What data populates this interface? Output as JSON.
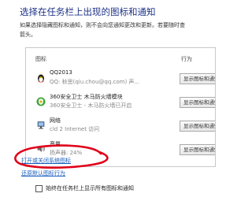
{
  "header": {
    "title": "选择在任务栏上出现的图标和通知",
    "description_line1": "如果选择隐藏图标和通知，则不会向您通知更改和更新。若要随时查",
    "description_line2": "箭头。"
  },
  "table": {
    "col_icon": "图标",
    "col_action": "行为",
    "rows": [
      {
        "name": "QQ2013",
        "sub": "QQ: 秋思(qiu.chou@qq.com) 声...",
        "action": "显示图标和通知",
        "icon": "qq-penguin-icon"
      },
      {
        "name": "360安全卫士 木马防火墙模块",
        "sub": "360安全卫士 - 木马防火墙已开启",
        "action": "显示图标和通知",
        "icon": "360-shield-icon"
      },
      {
        "name": "网络",
        "sub": "cld  2 Internet 访问",
        "action": "显示图标和通知",
        "icon": "network-icon"
      },
      {
        "name": "音量",
        "sub": "扬声器: 24%",
        "action": "显示图标和通知",
        "icon": "volume-icon"
      }
    ]
  },
  "links": {
    "system_icons": "打开或关闭系统图标",
    "restore_default": "还原默认图标行为"
  },
  "checkbox": {
    "label": "始终在任务栏上显示所有图标和通知"
  },
  "colors": {
    "title": "#1e3287",
    "link": "#1b5fbf",
    "annotation": "#e0001a"
  }
}
